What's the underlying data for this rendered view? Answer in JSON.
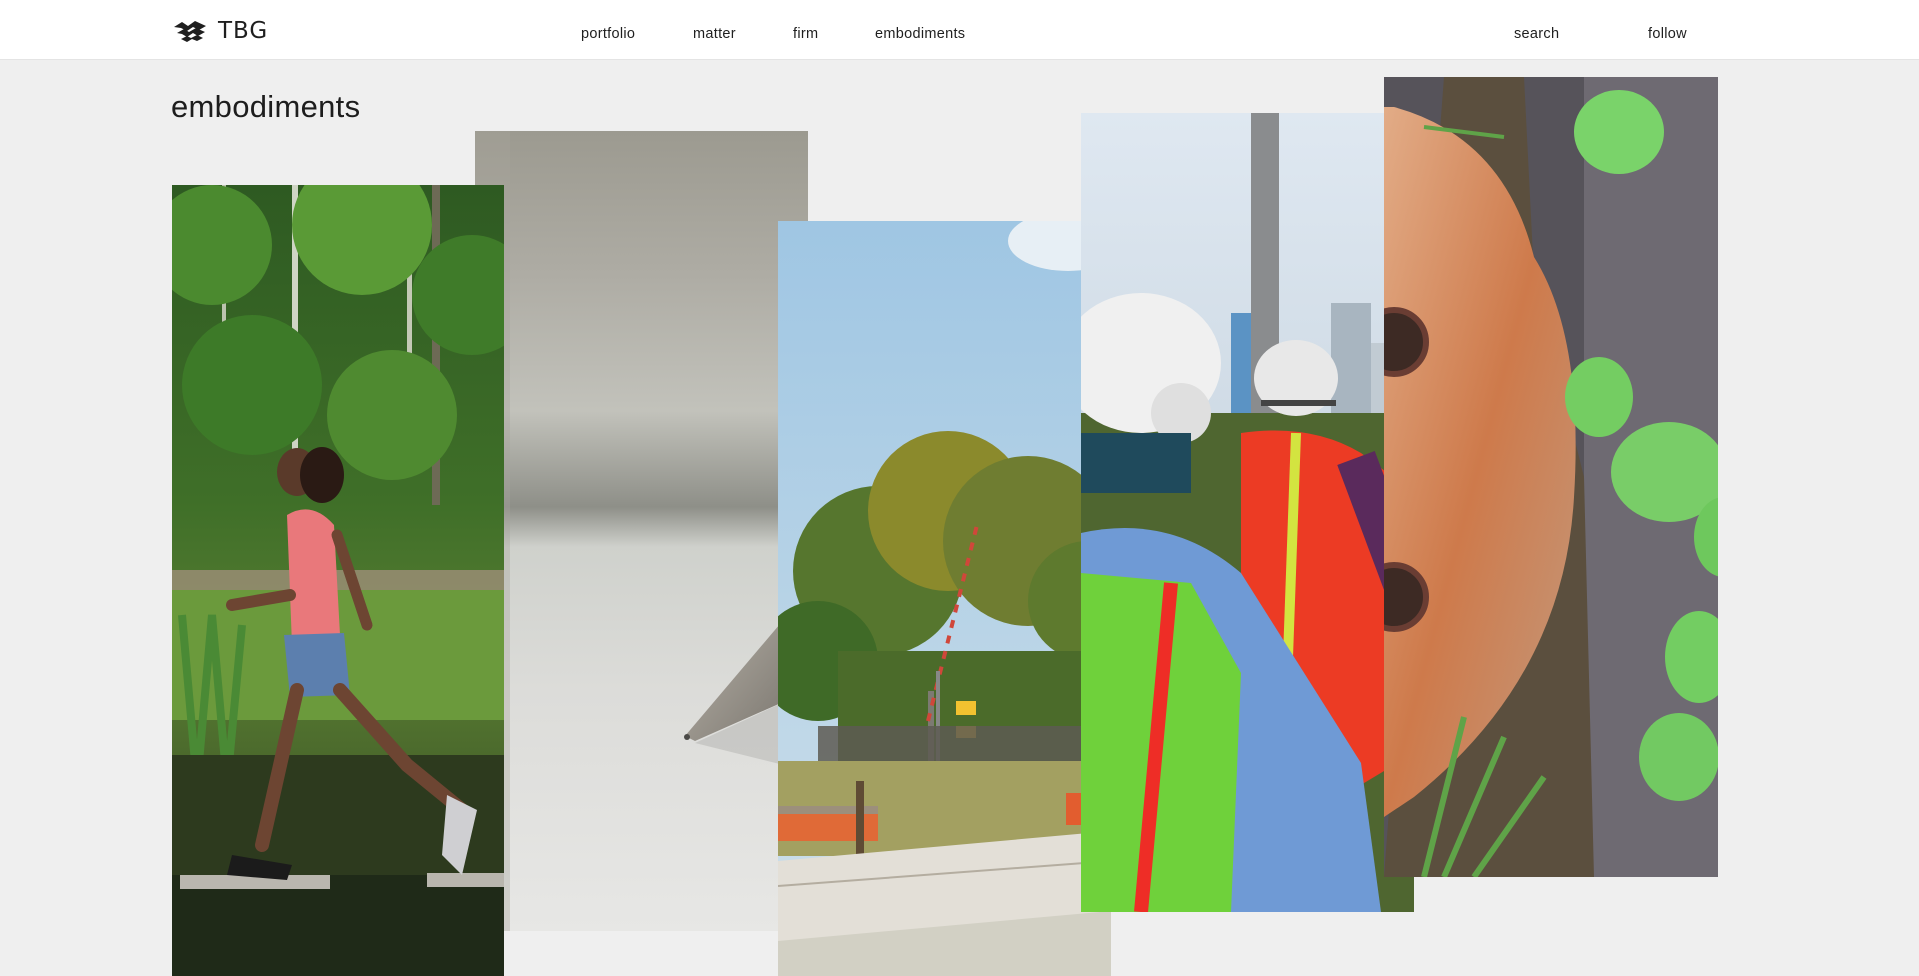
{
  "header": {
    "logo_text": "TBG",
    "nav": [
      {
        "label": "portfolio"
      },
      {
        "label": "matter"
      },
      {
        "label": "firm"
      },
      {
        "label": "embodiments"
      }
    ],
    "search_label": "search",
    "follow_label": "follow"
  },
  "main": {
    "title": "embodiments",
    "panels": [
      {
        "subject": "girl-hopping-stepping-stones"
      },
      {
        "subject": "pencil-tip-on-paper"
      },
      {
        "subject": "park-trees-railroad-crossing"
      },
      {
        "subject": "workers-hard-hats-safety-vests"
      },
      {
        "subject": "rock-lily-pads-pond"
      }
    ]
  },
  "colors": {
    "background": "#efefef",
    "header_bg": "#ffffff",
    "text": "#1f1f1f"
  }
}
